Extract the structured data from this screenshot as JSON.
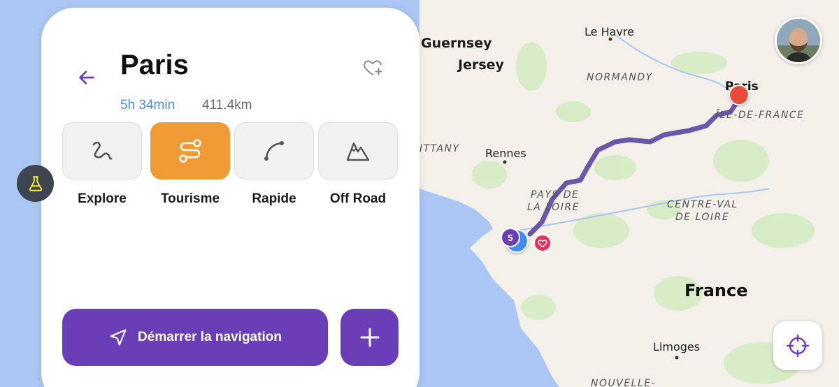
{
  "map": {
    "labels": {
      "guernsey": "Guernsey",
      "jersey": "Jersey",
      "le_havre": "Le Havre",
      "normandy": "NORMANDY",
      "paris": "Paris",
      "ile_de_france": "ÎLE-DE-FRANCE",
      "brittany": "ITTANY",
      "rennes": "Rennes",
      "pays_de_la_loire_1": "PAYS DE",
      "pays_de_la_loire_2": "LA LOIRE",
      "centre_val_de_loire_1": "CENTRE-VAL",
      "centre_val_de_loire_2": "DE LOIRE",
      "france": "France",
      "limoges": "Limoges",
      "nouvelle_aquitaine": "NOUVELLE-"
    },
    "cluster_count": "5",
    "colors": {
      "sea": "#aac6f2",
      "land": "#f2f0e9",
      "forest": "#d5ebc4",
      "route": "#6a57a8",
      "destination_pin": "#e94b3c",
      "favorite_pin": "#e0335e"
    }
  },
  "panel": {
    "title": "Paris",
    "duration": "5h 34min",
    "distance": "411.4km",
    "modes": [
      {
        "label": "Explore",
        "icon": "squiggle-icon",
        "selected": false
      },
      {
        "label": "Tourisme",
        "icon": "winding-route-icon",
        "selected": true
      },
      {
        "label": "Rapide",
        "icon": "curve-route-icon",
        "selected": false
      },
      {
        "label": "Off Road",
        "icon": "mountain-icon",
        "selected": false
      }
    ],
    "start_button": "Démarrer la navigation",
    "colors": {
      "accent": "#6a3eb6",
      "selected_mode": "#f09a36",
      "duration": "#4d8df0"
    }
  }
}
